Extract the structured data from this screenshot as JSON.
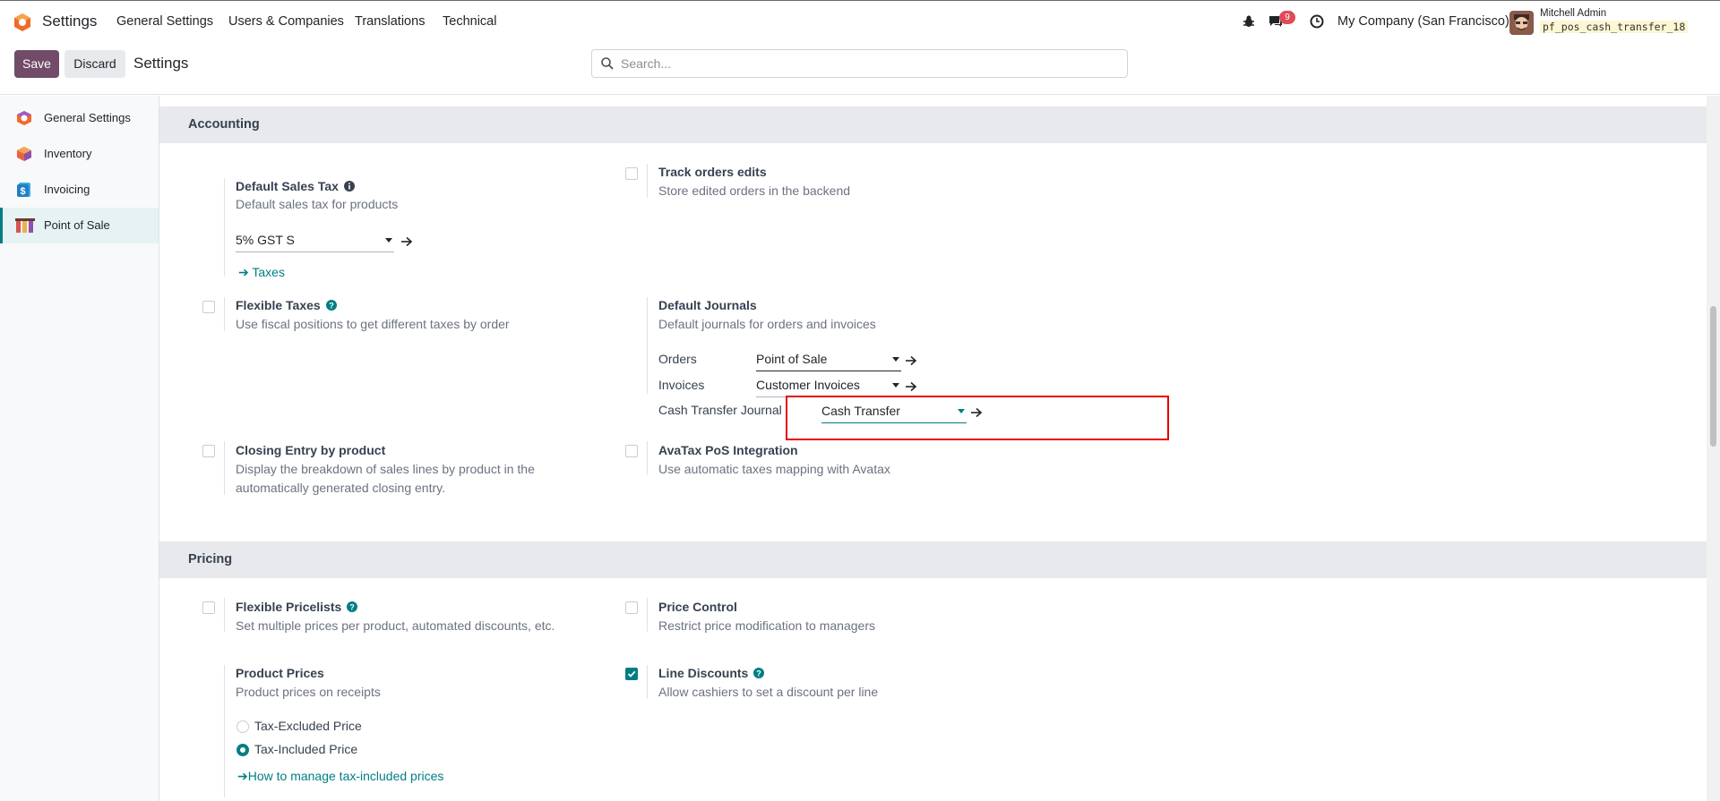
{
  "navbar": {
    "brand": "Settings",
    "menu": [
      "General Settings",
      "Users & Companies",
      "Translations",
      "Technical"
    ],
    "messages_count": "9",
    "company": "My Company (San Francisco)",
    "user_name": "Mitchell Admin",
    "database": "pf_pos_cash_transfer_18"
  },
  "control_panel": {
    "save_label": "Save",
    "discard_label": "Discard",
    "title": "Settings",
    "search_placeholder": "Search..."
  },
  "sidebar": {
    "items": [
      {
        "label": "General Settings",
        "icon": "odoo-icon"
      },
      {
        "label": "Inventory",
        "icon": "inventory-icon"
      },
      {
        "label": "Invoicing",
        "icon": "invoicing-icon"
      },
      {
        "label": "Point of Sale",
        "icon": "point-of-sale-icon",
        "active": true
      }
    ]
  },
  "accounting": {
    "title": "Accounting",
    "default_sales_tax": {
      "title": "Default Sales Tax",
      "desc": "Default sales tax for products",
      "value": "5% GST S",
      "link": "Taxes"
    },
    "track_orders": {
      "title": "Track orders edits",
      "desc": "Store edited orders in the backend",
      "checked": false
    },
    "flexible_taxes": {
      "title": "Flexible Taxes",
      "desc": "Use fiscal positions to get different taxes by order",
      "checked": false
    },
    "default_journals": {
      "title": "Default Journals",
      "desc": "Default journals for orders and invoices",
      "orders_label": "Orders",
      "orders_value": "Point of Sale",
      "invoices_label": "Invoices",
      "invoices_value": "Customer Invoices",
      "cash_label": "Cash Transfer Journal",
      "cash_value": "Cash Transfer"
    },
    "closing_entry": {
      "title": "Closing Entry by product",
      "desc_line1": "Display the breakdown of sales lines by product in the",
      "desc_line2": "automatically generated closing entry.",
      "checked": false
    },
    "avatax": {
      "title": "AvaTax PoS Integration",
      "desc": "Use automatic taxes mapping with Avatax",
      "checked": false
    }
  },
  "pricing": {
    "title": "Pricing",
    "flexible_pricelists": {
      "title": "Flexible Pricelists",
      "desc": "Set multiple prices per product, automated discounts, etc.",
      "checked": false
    },
    "price_control": {
      "title": "Price Control",
      "desc": "Restrict price modification to managers",
      "checked": false
    },
    "product_prices": {
      "title": "Product Prices",
      "desc": "Product prices on receipts",
      "option1": "Tax-Excluded Price",
      "option2": "Tax-Included Price",
      "selected": "Tax-Included Price",
      "link": "How to manage tax-included prices"
    },
    "line_discounts": {
      "title": "Line Discounts",
      "desc": "Allow cashiers to set a discount per line",
      "checked": true
    }
  },
  "colors": {
    "brand": "#714b67",
    "accent": "#017e84",
    "highlight": "#e60000"
  }
}
